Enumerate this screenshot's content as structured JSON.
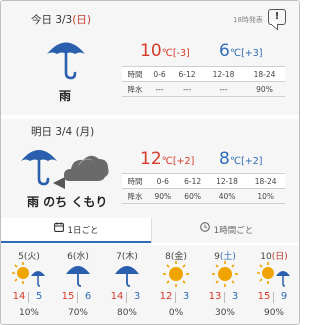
{
  "today": {
    "date_prefix": "今日 3/3",
    "weekday": "(日)",
    "issued": "18時発表",
    "weather": "雨",
    "icon": "umbrella-icon",
    "high": "10",
    "high_diff": "[-3]",
    "low": "6",
    "low_diff": "[+3]",
    "unit": "℃",
    "row_time_label": "時間",
    "row_rain_label": "降水",
    "periods": [
      "0-6",
      "6-12",
      "12-18",
      "18-24"
    ],
    "rain": [
      "---",
      "---",
      "---",
      "90%"
    ]
  },
  "tomorrow": {
    "date": "明日 3/4 (月)",
    "weather": "雨 のち くもり",
    "icon": "umbrella-then-cloud-icon",
    "high": "12",
    "high_diff": "[+2]",
    "low": "8",
    "low_diff": "[+2]",
    "unit": "℃",
    "row_time_label": "時間",
    "row_rain_label": "降水",
    "periods": [
      "0-6",
      "6-12",
      "12-18",
      "18-24"
    ],
    "rain": [
      "90%",
      "60%",
      "40%",
      "10%"
    ]
  },
  "tabs": {
    "daily": "1日ごと",
    "hourly": "1時間ごと"
  },
  "week": [
    {
      "date": "5",
      "wd": "(火)",
      "kind": "",
      "icon": "sun-umbrella-icon",
      "hi": "14",
      "lo": "5",
      "pop": "10%"
    },
    {
      "date": "6",
      "wd": "(水)",
      "kind": "",
      "icon": "umbrella-icon",
      "hi": "15",
      "lo": "6",
      "pop": "70%"
    },
    {
      "date": "7",
      "wd": "(木)",
      "kind": "",
      "icon": "umbrella-icon",
      "hi": "14",
      "lo": "3",
      "pop": "80%"
    },
    {
      "date": "8",
      "wd": "(金)",
      "kind": "",
      "icon": "sun-icon",
      "hi": "12",
      "lo": "3",
      "pop": "0%"
    },
    {
      "date": "9",
      "wd": "(土)",
      "kind": "sat",
      "icon": "sun-icon",
      "hi": "13",
      "lo": "3",
      "pop": "30%"
    },
    {
      "date": "10",
      "wd": "(日)",
      "kind": "sun",
      "icon": "sun-umbrella-icon",
      "hi": "15",
      "lo": "9",
      "pop": "90%"
    }
  ],
  "colors": {
    "high": "#d83a2a",
    "low": "#2f6db5",
    "umbrella": "#2a5fae",
    "cloud": "#555555",
    "sun": "#f0a400"
  }
}
